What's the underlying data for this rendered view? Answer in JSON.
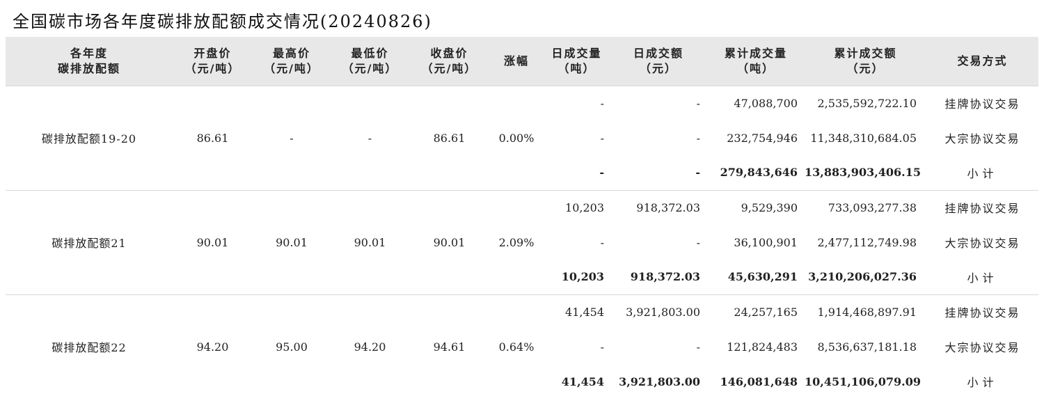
{
  "title": "全国碳市场各年度碳排放配额成交情况(20240826)",
  "headers": [
    {
      "line1": "各年度",
      "line2": "碳排放配额"
    },
    {
      "line1": "开盘价",
      "line2": "（元/吨）"
    },
    {
      "line1": "最高价",
      "line2": "（元/吨）"
    },
    {
      "line1": "最低价",
      "line2": "（元/吨）"
    },
    {
      "line1": "收盘价",
      "line2": "（元/吨）"
    },
    {
      "line1": "涨幅",
      "line2": ""
    },
    {
      "line1": "日成交量",
      "line2": "（吨）"
    },
    {
      "line1": "日成交额",
      "line2": "（元）"
    },
    {
      "line1": "累计成交量",
      "line2": "（吨）"
    },
    {
      "line1": "累计成交额",
      "line2": "（元）"
    },
    {
      "line1": "交易方式",
      "line2": ""
    }
  ],
  "groups": [
    {
      "name": "碳排放配额19-20",
      "open": "86.61",
      "high": "-",
      "low": "-",
      "close": "86.61",
      "change": "0.00%",
      "rows": [
        {
          "daily_volume": "-",
          "daily_amount": "-",
          "cum_volume": "47,088,700",
          "cum_amount": "2,535,592,722.10",
          "method": "挂牌协议交易"
        },
        {
          "daily_volume": "-",
          "daily_amount": "-",
          "cum_volume": "232,754,946",
          "cum_amount": "11,348,310,684.05",
          "method": "大宗协议交易"
        },
        {
          "daily_volume": "-",
          "daily_amount": "-",
          "cum_volume": "279,843,646",
          "cum_amount": "13,883,903,406.15",
          "method": "小计"
        }
      ]
    },
    {
      "name": "碳排放配额21",
      "open": "90.01",
      "high": "90.01",
      "low": "90.01",
      "close": "90.01",
      "change": "2.09%",
      "rows": [
        {
          "daily_volume": "10,203",
          "daily_amount": "918,372.03",
          "cum_volume": "9,529,390",
          "cum_amount": "733,093,277.38",
          "method": "挂牌协议交易"
        },
        {
          "daily_volume": "-",
          "daily_amount": "-",
          "cum_volume": "36,100,901",
          "cum_amount": "2,477,112,749.98",
          "method": "大宗协议交易"
        },
        {
          "daily_volume": "10,203",
          "daily_amount": "918,372.03",
          "cum_volume": "45,630,291",
          "cum_amount": "3,210,206,027.36",
          "method": "小计"
        }
      ]
    },
    {
      "name": "碳排放配额22",
      "open": "94.20",
      "high": "95.00",
      "low": "94.20",
      "close": "94.61",
      "change": "0.64%",
      "rows": [
        {
          "daily_volume": "41,454",
          "daily_amount": "3,921,803.00",
          "cum_volume": "24,257,165",
          "cum_amount": "1,914,468,897.91",
          "method": "挂牌协议交易"
        },
        {
          "daily_volume": "-",
          "daily_amount": "-",
          "cum_volume": "121,824,483",
          "cum_amount": "8,536,637,181.18",
          "method": "大宗协议交易"
        },
        {
          "daily_volume": "41,454",
          "daily_amount": "3,921,803.00",
          "cum_volume": "146,081,648",
          "cum_amount": "10,451,106,079.09",
          "method": "小计"
        }
      ]
    }
  ]
}
